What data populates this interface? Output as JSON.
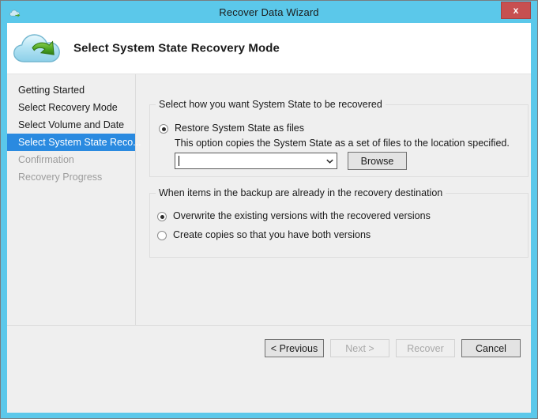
{
  "window": {
    "title": "Recover Data Wizard",
    "title_icon": "cloud-arrow-icon",
    "close_label": "x",
    "frame_color": "#5bc8ea",
    "close_color": "#c75050"
  },
  "header": {
    "icon": "cloud-recovery-icon",
    "title": "Select System State Recovery Mode"
  },
  "sidebar": {
    "items": [
      {
        "label": "Getting Started",
        "state": "normal"
      },
      {
        "label": "Select Recovery Mode",
        "state": "normal"
      },
      {
        "label": "Select Volume and Date",
        "state": "normal"
      },
      {
        "label": "Select System State Reco...",
        "state": "selected"
      },
      {
        "label": "Confirmation",
        "state": "disabled"
      },
      {
        "label": "Recovery Progress",
        "state": "disabled"
      }
    ],
    "selected_color": "#2a8ae0"
  },
  "main": {
    "mode_group": {
      "legend": "Select how you want System State to be recovered",
      "option_label": "Restore System State as files",
      "option_checked": true,
      "description": "This option copies the System State as a set of files to the location specified.",
      "path_value": "",
      "path_placeholder": "",
      "browse_label": "Browse",
      "combo_arrow_icon": "chevron-down-icon"
    },
    "destination_group": {
      "legend": "When items in the backup are already in the recovery destination",
      "options": [
        {
          "label": "Overwrite the existing versions with the recovered versions",
          "checked": true
        },
        {
          "label": "Create copies so that you have both versions",
          "checked": false
        }
      ]
    }
  },
  "footer": {
    "buttons": [
      {
        "label": "< Previous",
        "enabled": true
      },
      {
        "label": "Next >",
        "enabled": false
      },
      {
        "label": "Recover",
        "enabled": false
      },
      {
        "label": "Cancel",
        "enabled": true
      }
    ]
  }
}
